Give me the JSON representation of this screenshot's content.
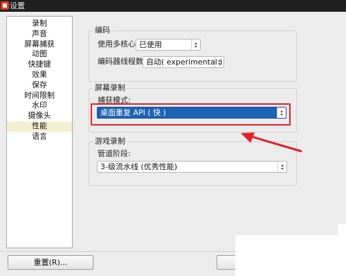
{
  "window": {
    "title": "设置"
  },
  "sidebar": {
    "items": [
      {
        "label": "录制"
      },
      {
        "label": "声音"
      },
      {
        "label": "屏幕捕获"
      },
      {
        "label": "动图"
      },
      {
        "label": "快捷键"
      },
      {
        "label": "效果"
      },
      {
        "label": "保存"
      },
      {
        "label": "时间限制"
      },
      {
        "label": "水印"
      },
      {
        "label": "摄像头"
      },
      {
        "label": "性能",
        "selected": true
      },
      {
        "label": "语言"
      }
    ]
  },
  "encoding": {
    "title": "编码",
    "multicore_label": "使用多核心:",
    "multicore_value": "已使用",
    "threads_label": "编码器线程数:",
    "threads_value": "自动( experimental )"
  },
  "screen_recording": {
    "title": "屏幕录制",
    "capture_label": "捕获模式:",
    "capture_value": "桌面重复 API ( 快 )"
  },
  "game_recording": {
    "title": "游戏录制",
    "pipeline_label": "管道阶段:",
    "pipeline_value": "3-级流水线 (优秀性能)"
  },
  "footer": {
    "reset_label": "重置(R)..."
  },
  "colors": {
    "annotation_red": "#e0202a",
    "selection_blue": "#1e63b6",
    "sidebar_selected": "#f5efd2"
  }
}
